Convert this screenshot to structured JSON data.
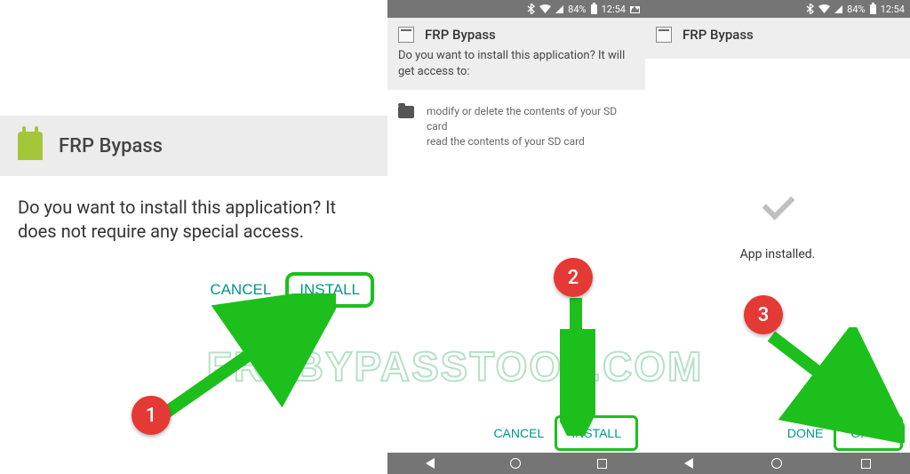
{
  "status": {
    "battery": "84%",
    "time": "12:54"
  },
  "panel1": {
    "title": "FRP Bypass",
    "prompt": "Do you want to install this application? It does not require any special access.",
    "cancel": "CANCEL",
    "install": "INSTALL"
  },
  "panel2": {
    "title": "FRP Bypass",
    "prompt": "Do you want to install this application? It will get access to:",
    "perm1": "modify or delete the contents of your SD card",
    "perm2": "read the contents of your SD card",
    "cancel": "CANCEL",
    "install": "INSTALL"
  },
  "panel3": {
    "title": "FRP Bypass",
    "installed": "App installed.",
    "done": "DONE",
    "open": "OPEN"
  },
  "annotations": {
    "step1": "1",
    "step2": "2",
    "step3": "3"
  },
  "watermark": "FRPBYPASSTOOL.COM"
}
